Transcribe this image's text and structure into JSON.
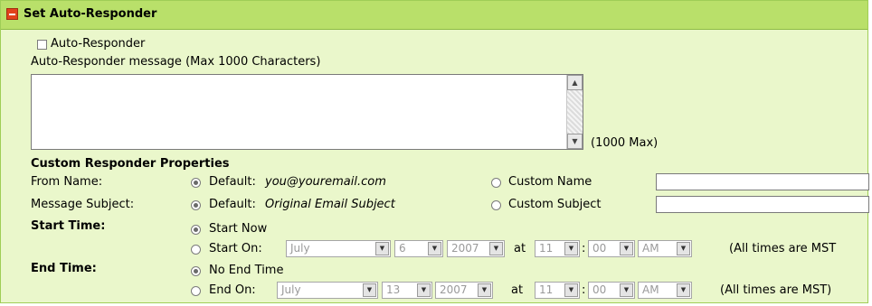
{
  "panel": {
    "title": "Set Auto-Responder",
    "collapse_icon": "minus-icon"
  },
  "auto_responder": {
    "checkbox_label": "Auto-Responder",
    "checked": false,
    "message_label": "Auto-Responder message (Max 1000 Characters)",
    "message_value": "",
    "max_note": "(1000 Max)"
  },
  "properties": {
    "heading": "Custom Responder Properties",
    "from_name": {
      "label": "From Name:",
      "default_prefix": "Default:",
      "default_value": "you@youremail.com",
      "custom_label": "Custom Name",
      "custom_value": ""
    },
    "message_subject": {
      "label": "Message Subject:",
      "default_prefix": "Default:",
      "default_value": "Original Email Subject",
      "custom_label": "Custom Subject",
      "custom_value": ""
    },
    "start_time": {
      "label": "Start Time:",
      "now_label": "Start Now",
      "on_label": "Start On:",
      "month": "July",
      "day": "6",
      "year": "2007",
      "at_label": "at",
      "hour": "11",
      "colon": ":",
      "minute": "00",
      "ampm": "AM",
      "tz_note": "(All times are MST"
    },
    "end_time": {
      "label": "End Time:",
      "none_label": "No End Time",
      "on_label": "End On:",
      "month": "July",
      "day": "13",
      "year": "2007",
      "at_label": "at",
      "hour": "11",
      "colon": ":",
      "minute": "00",
      "ampm": "AM",
      "tz_note": "(All times are MST)"
    }
  }
}
